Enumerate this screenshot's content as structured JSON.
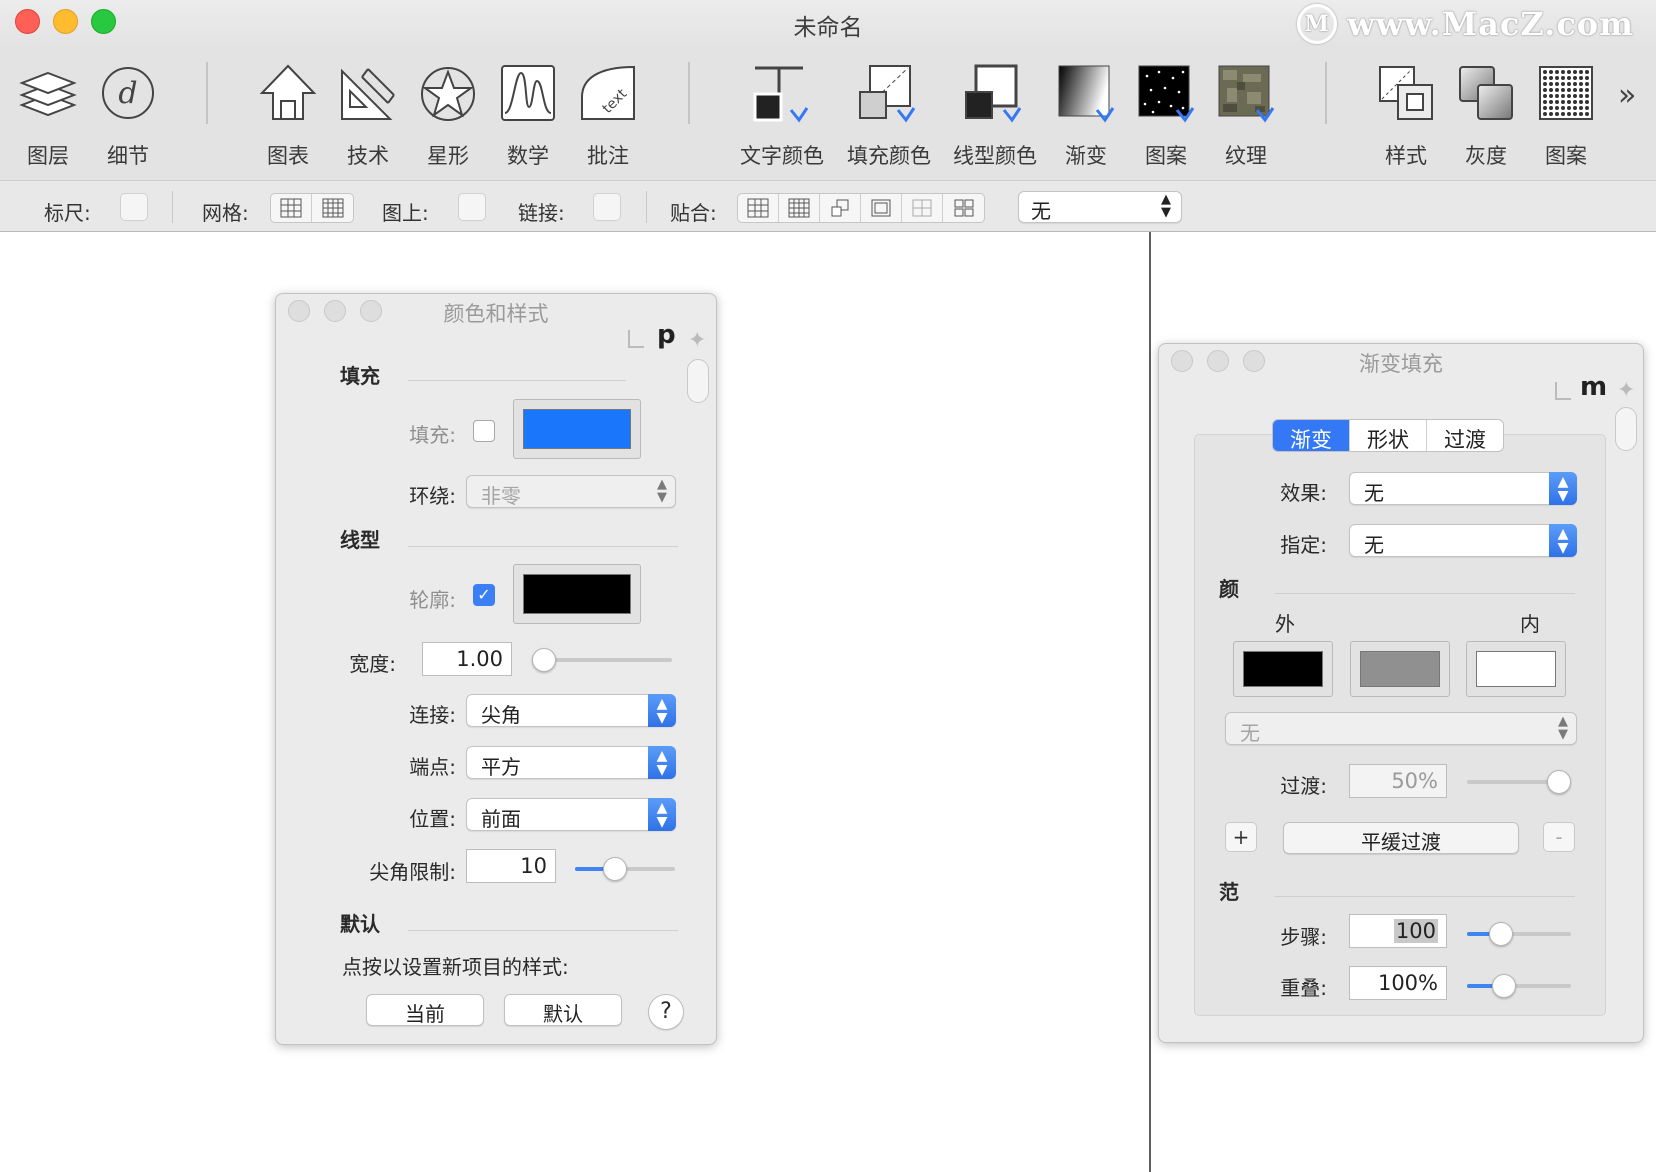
{
  "window": {
    "title": "未命名",
    "watermark": "www.MacZ.com",
    "watermark_logo": "M"
  },
  "colors": {
    "fill": "#1a77fb",
    "outline": "#000000",
    "outer": "#000000",
    "middle": "#909090",
    "inner": "#ffffff",
    "accent": "#3478f6"
  },
  "toolbar": {
    "layers": "图层",
    "details": "细节",
    "chart": "图表",
    "tech": "技术",
    "star": "星形",
    "math": "数学",
    "annotate": "批注",
    "text_color": "文字颜色",
    "fill_color": "填充颜色",
    "line_color": "线型颜色",
    "gradient": "渐变",
    "pattern": "图案",
    "texture": "纹理",
    "style": "样式",
    "gray": "灰度",
    "pattern2": "图案",
    "overflow": "»"
  },
  "optbar": {
    "ruler": "标尺:",
    "grid": "网格:",
    "on_drawing": "图上:",
    "link": "链接:",
    "snap": "贴合:",
    "snap_value": "无"
  },
  "style_panel": {
    "title": "颜色和样式",
    "corner": "p",
    "fill_header": "填充",
    "fill_label": "填充:",
    "fill_checked": false,
    "winding_label": "环绕:",
    "winding_value": "非零",
    "line_header": "线型",
    "outline_label": "轮廓:",
    "outline_checked": true,
    "width_label": "宽度:",
    "width_value": "1.00",
    "width_level": 0.02,
    "join_label": "连接:",
    "join_value": "尖角",
    "cap_label": "端点:",
    "cap_value": "平方",
    "position_label": "位置:",
    "position_value": "前面",
    "miter_label": "尖角限制:",
    "miter_value": "10",
    "miter_level": 0.4,
    "default_header": "默认",
    "default_hint": "点按以设置新项目的样式:",
    "current_btn": "当前",
    "default_btn": "默认",
    "help": "?"
  },
  "gradient_panel": {
    "title": "渐变填充",
    "corner": "m",
    "tabs": [
      "渐变",
      "形状",
      "过渡"
    ],
    "selected_tab": 0,
    "effect_label": "效果:",
    "effect_value": "无",
    "assign_label": "指定:",
    "assign_value": "无",
    "color_header": "颜",
    "outer_label": "外",
    "inner_label": "内",
    "blend_popup": "无",
    "transition_label": "过渡:",
    "transition_value": "50%",
    "transition_level": 1.0,
    "plus": "+",
    "smooth_btn": "平缓过渡",
    "minus": "-",
    "range_header": "范",
    "steps_label": "步骤:",
    "steps_value": "100",
    "steps_level": 0.33,
    "overlap_label": "重叠:",
    "overlap_value": "100%",
    "overlap_level": 0.36
  }
}
